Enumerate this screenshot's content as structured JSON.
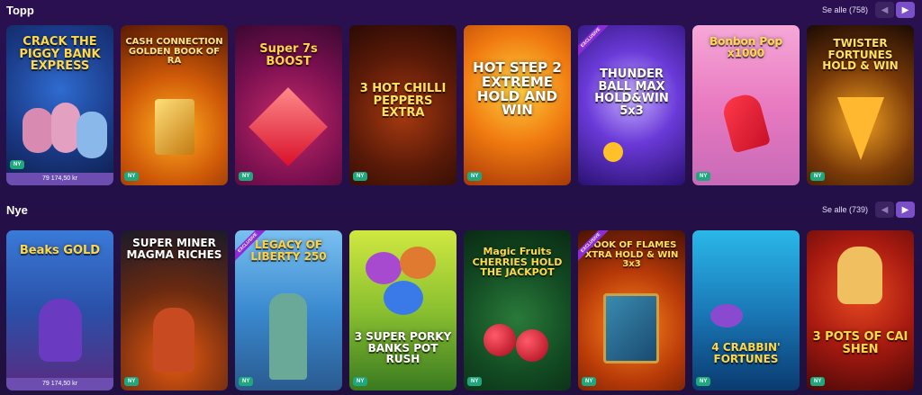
{
  "sections": [
    {
      "title": "Topp",
      "see_all": "Se alle (758)",
      "games": [
        {
          "name": "CRACK THE PIGGY BANK EXPRESS",
          "badge": "NY",
          "jackpot": "79 174,50 kr"
        },
        {
          "name": "CASH CONNECTION GOLDEN BOOK OF RA",
          "badge": "NY"
        },
        {
          "name": "Super 7s BOOST",
          "badge": "NY"
        },
        {
          "name": "3 HOT CHILLI PEPPERS EXTRA",
          "badge": "NY"
        },
        {
          "name": "HOT STEP 2 EXTREME HOLD AND WIN",
          "badge": "NY"
        },
        {
          "name": "THUNDER BALL MAX HOLD&WIN 5x3",
          "badge": "",
          "exclusive": "EXCLUSIVE"
        },
        {
          "name": "Bonbon Pop x1000",
          "badge": "NY"
        },
        {
          "name": "TWISTER FORTUNES HOLD & WIN",
          "badge": "NY"
        }
      ]
    },
    {
      "title": "Nye",
      "see_all": "Se alle (739)",
      "games": [
        {
          "name": "Beaks GOLD",
          "badge": "",
          "jackpot": "79 174,50 kr"
        },
        {
          "name": "SUPER MINER MAGMA RICHES",
          "badge": "NY"
        },
        {
          "name": "LEGACY OF LIBERTY 250",
          "badge": "NY",
          "exclusive": "EXCLUSIVE"
        },
        {
          "name": "3 SUPER PORKY BANKS POT RUSH",
          "badge": "NY"
        },
        {
          "name": "Magic Fruits CHERRIES HOLD THE JACKPOT",
          "badge": "NY"
        },
        {
          "name": "BOOK OF FLAMES XTRA HOLD & WIN 3x3",
          "badge": "NY",
          "exclusive": "EXCLUSIVE"
        },
        {
          "name": "4 CRABBIN' FORTUNES",
          "badge": "NY"
        },
        {
          "name": "3 POTS OF CAI SHEN",
          "badge": "NY"
        }
      ]
    }
  ],
  "nav": {
    "prev_icon": "chevron-left-icon",
    "next_icon": "chevron-right-icon"
  }
}
